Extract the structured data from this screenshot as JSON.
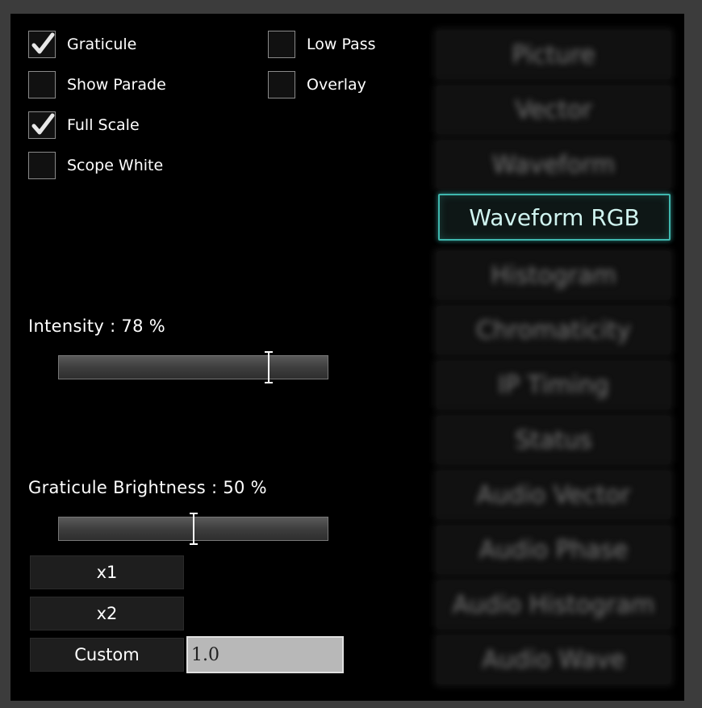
{
  "checkboxes": [
    {
      "label": "Graticule",
      "checked": true
    },
    {
      "label": "Show Parade",
      "checked": false
    },
    {
      "label": "Full Scale",
      "checked": true
    },
    {
      "label": "Scope White",
      "checked": false
    },
    {
      "label": "Low Pass",
      "checked": false
    },
    {
      "label": "Overlay",
      "checked": false
    }
  ],
  "intensity": {
    "label": "Intensity : 78 %",
    "value_percent": 78
  },
  "graticule_brightness": {
    "label": "Graticule Brightness : 50 %",
    "value_percent": 50
  },
  "zoom": {
    "x1_label": "x1",
    "x2_label": "x2",
    "custom_label": "Custom",
    "custom_value": "1.0"
  },
  "scope_buttons": [
    {
      "label": "Picture",
      "active": false
    },
    {
      "label": "Vector",
      "active": false
    },
    {
      "label": "Waveform",
      "active": false
    },
    {
      "label": "Waveform RGB",
      "active": true
    },
    {
      "label": "Histogram",
      "active": false
    },
    {
      "label": "Chromaticity",
      "active": false
    },
    {
      "label": "IP Timing",
      "active": false
    },
    {
      "label": "Status",
      "active": false
    },
    {
      "label": "Audio Vector",
      "active": false
    },
    {
      "label": "Audio Phase",
      "active": false
    },
    {
      "label": "Audio Histogram",
      "active": false
    },
    {
      "label": "Audio Wave",
      "active": false
    }
  ],
  "colors": {
    "accent": "#3fb7ae",
    "panel_bg": "#000000",
    "frame_bg": "#3c3c3c"
  }
}
